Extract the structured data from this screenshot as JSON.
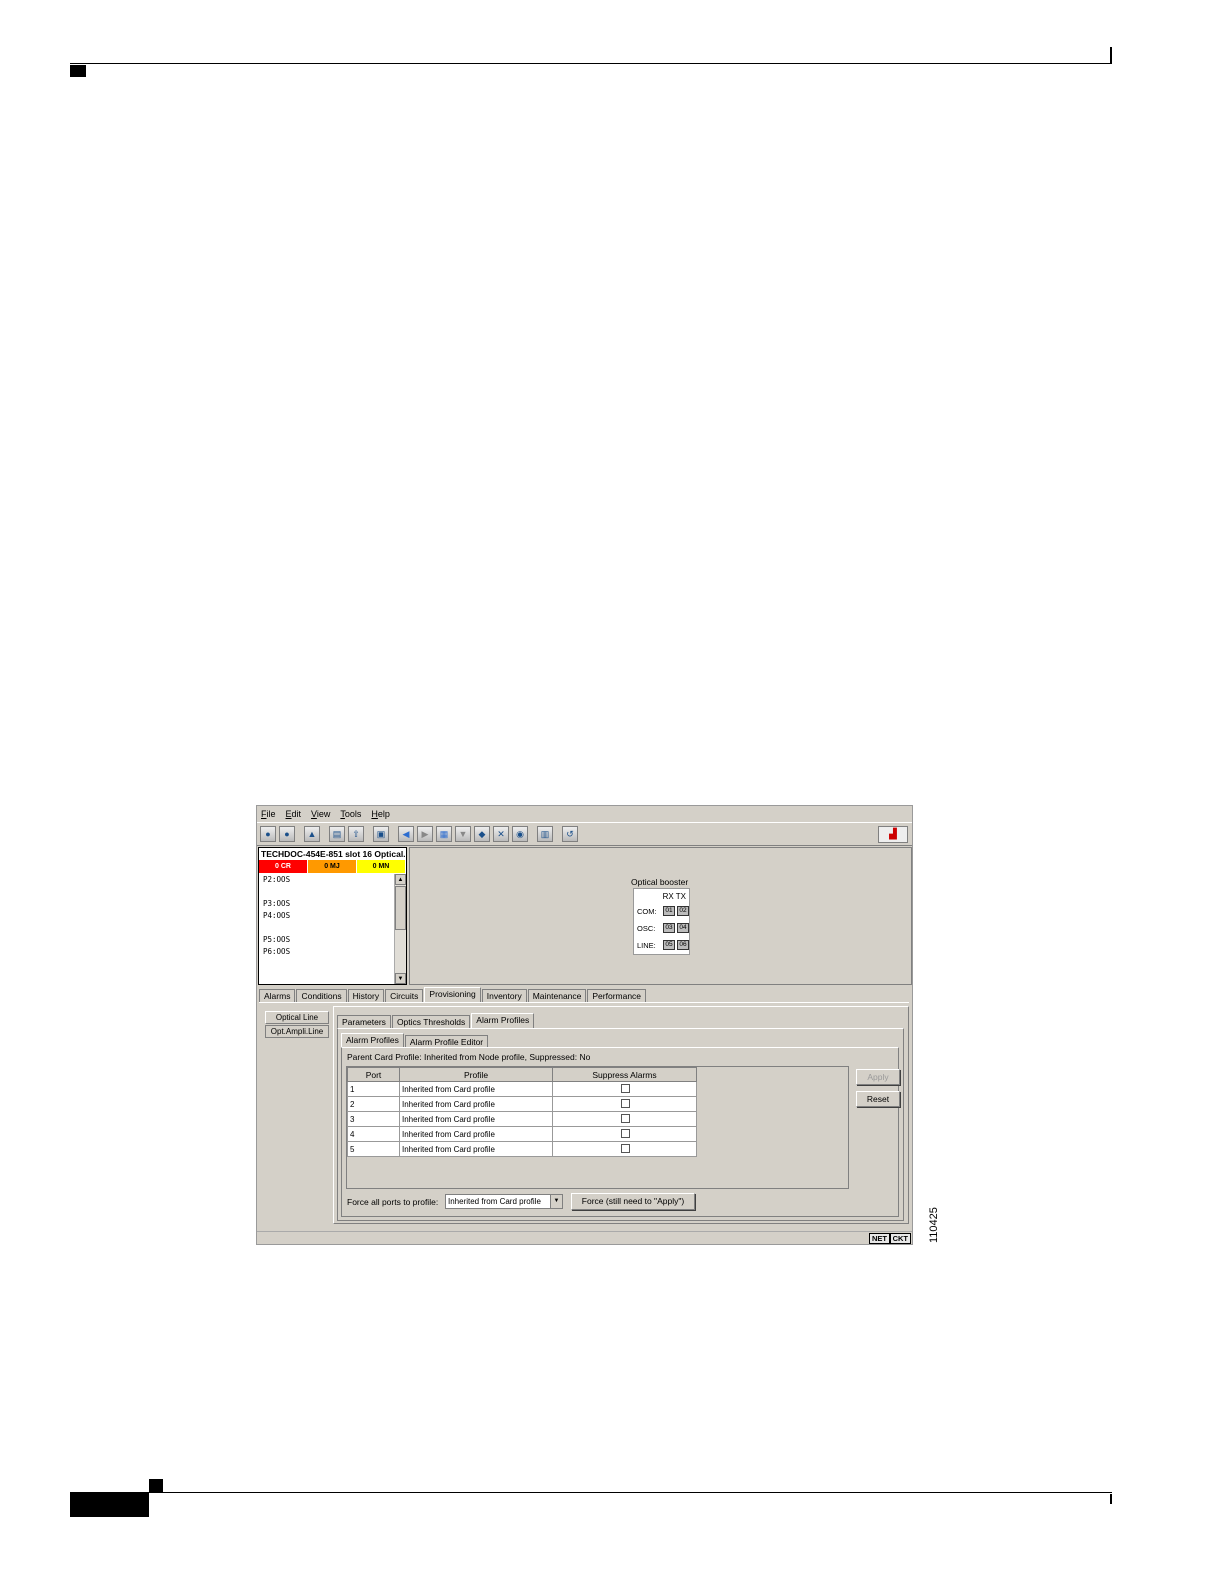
{
  "menu": [
    "File",
    "Edit",
    "View",
    "Tools",
    "Help"
  ],
  "status_panel": {
    "title": "TECHDOC-454E-851 slot 16 Optical...",
    "alarms": {
      "critical": "0 CR",
      "major": "0 MJ",
      "minor": "0 MN"
    },
    "lines": [
      "P2:OOS",
      "",
      "P3:OOS",
      "P4:OOS",
      "",
      "P5:OOS",
      "P6:OOS"
    ]
  },
  "card": {
    "title": "Optical booster",
    "rx": "RX",
    "tx": "TX",
    "rows": [
      {
        "label": "COM:",
        "rx": "01",
        "tx": "02"
      },
      {
        "label": "OSC:",
        "rx": "03",
        "tx": "04"
      },
      {
        "label": "LINE:",
        "rx": "05",
        "tx": "06"
      }
    ]
  },
  "tabs": [
    "Alarms",
    "Conditions",
    "History",
    "Circuits",
    "Provisioning",
    "Inventory",
    "Maintenance",
    "Performance"
  ],
  "side_tabs": [
    "Optical Line",
    "Opt.Ampli.Line"
  ],
  "sub_tabs": [
    "Parameters",
    "Optics Thresholds",
    "Alarm Profiles"
  ],
  "alarm_tabs": [
    "Alarm Profiles",
    "Alarm Profile Editor"
  ],
  "parent_profile": "Parent Card Profile: Inherited from Node profile, Suppressed: No",
  "table": {
    "headers": [
      "Port",
      "Profile",
      "Suppress Alarms"
    ],
    "rows": [
      {
        "port": "1",
        "profile": "Inherited from Card profile"
      },
      {
        "port": "2",
        "profile": "Inherited from Card profile"
      },
      {
        "port": "3",
        "profile": "Inherited from Card profile"
      },
      {
        "port": "4",
        "profile": "Inherited from Card profile"
      },
      {
        "port": "5",
        "profile": "Inherited from Card profile"
      }
    ]
  },
  "buttons": {
    "apply": "Apply",
    "reset": "Reset",
    "force": "Force (still need to \"Apply\")"
  },
  "force_label": "Force all ports to profile:",
  "force_select": "Inherited from Card profile",
  "statusbar": {
    "net": "NET",
    "ckt": "CKT"
  },
  "figure_id": "110425"
}
